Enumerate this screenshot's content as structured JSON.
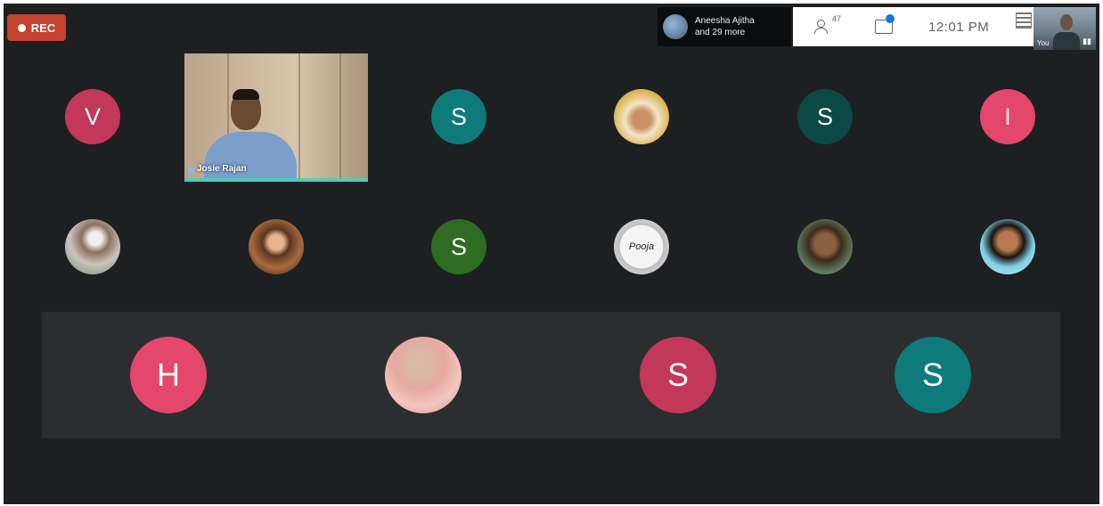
{
  "recording": {
    "label": "REC"
  },
  "presenting": {
    "line1": "Aneesha Ajitha",
    "line2": "and 29 more"
  },
  "toolbar": {
    "people_count": "47",
    "time": "12:01 PM"
  },
  "self_view": {
    "label": "You"
  },
  "featured_tile": {
    "name": "Josie Rajan"
  },
  "participants_row1": [
    {
      "initial": "V",
      "color": "#c2375a"
    },
    {
      "initial": "S",
      "color": "#0e7a7a"
    },
    {
      "initial": "",
      "photo": "woman-headscarf"
    },
    {
      "initial": "S",
      "color": "#0b4a44"
    },
    {
      "initial": "I",
      "color": "#e5466b"
    }
  ],
  "participants_row2": [
    {
      "initial": "",
      "photo": "couple"
    },
    {
      "initial": "",
      "photo": "girl"
    },
    {
      "initial": "S",
      "color": "#2f6b22"
    },
    {
      "initial": "",
      "photo": "doodle",
      "text": "Pooja"
    },
    {
      "initial": "",
      "photo": "man"
    },
    {
      "initial": "",
      "photo": "lady"
    }
  ],
  "participants_row3": [
    {
      "initial": "H",
      "color": "#e5466b"
    },
    {
      "initial": "",
      "photo": "bride"
    },
    {
      "initial": "S",
      "color": "#c2375a"
    },
    {
      "initial": "S",
      "color": "#0e7a7a"
    }
  ]
}
